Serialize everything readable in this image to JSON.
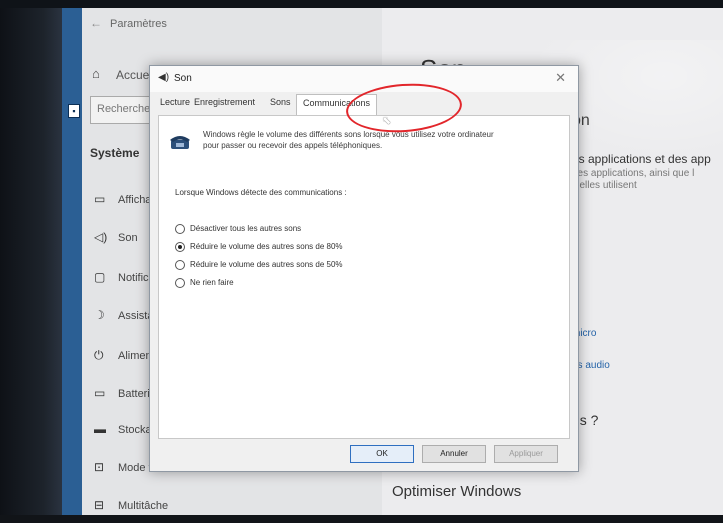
{
  "settings": {
    "window_title": "Paramètres",
    "nav": {
      "home_label": "Accueil",
      "search_placeholder": "Rechercher",
      "section_title": "Système",
      "items": [
        {
          "label": "Affichage",
          "icon": "monitor-icon"
        },
        {
          "label": "Son",
          "icon": "speaker-icon"
        },
        {
          "label": "Notifications",
          "icon": "notification-icon"
        },
        {
          "label": "Assistant de concentration",
          "icon": "moon-icon"
        },
        {
          "label": "Alimentation",
          "icon": "power-icon"
        },
        {
          "label": "Batterie",
          "icon": "battery-icon"
        },
        {
          "label": "Stockage",
          "icon": "storage-icon"
        },
        {
          "label": "Mode tablette",
          "icon": "tablet-icon"
        },
        {
          "label": "Multitâche",
          "icon": "multitask-icon"
        }
      ]
    },
    "main": {
      "title": "Son",
      "subtitle": "on",
      "text1": "es applications et des app",
      "text2": "des applications, ainsi que l",
      "text3": "u'elles utilisent",
      "link1": "micro",
      "link2": "es audio",
      "question": "ns ?",
      "optimize": "Optimiser Windows"
    }
  },
  "dialog": {
    "title": "Son",
    "tabs": [
      "Lecture",
      "Enregistrement",
      "Sons",
      "Communications"
    ],
    "active_tab": "Communications",
    "description": [
      "Windows règle le volume des différents sons lorsque vous utilisez votre ordinateur",
      "pour passer ou recevoir des appels téléphoniques."
    ],
    "when_label": "Lorsque Windows détecte des communications :",
    "options": [
      {
        "label": "Désactiver tous les autres sons",
        "selected": false
      },
      {
        "label": "Réduire le volume des autres sons de 80%",
        "selected": true
      },
      {
        "label": "Réduire le volume des autres sons de 50%",
        "selected": false
      },
      {
        "label": "Ne rien faire",
        "selected": false
      }
    ],
    "buttons": {
      "ok": "OK",
      "cancel": "Annuler",
      "apply": "Appliquer"
    }
  },
  "colors": {
    "annotation_circle": "#e2262b",
    "accent": "#2f6fc0"
  }
}
